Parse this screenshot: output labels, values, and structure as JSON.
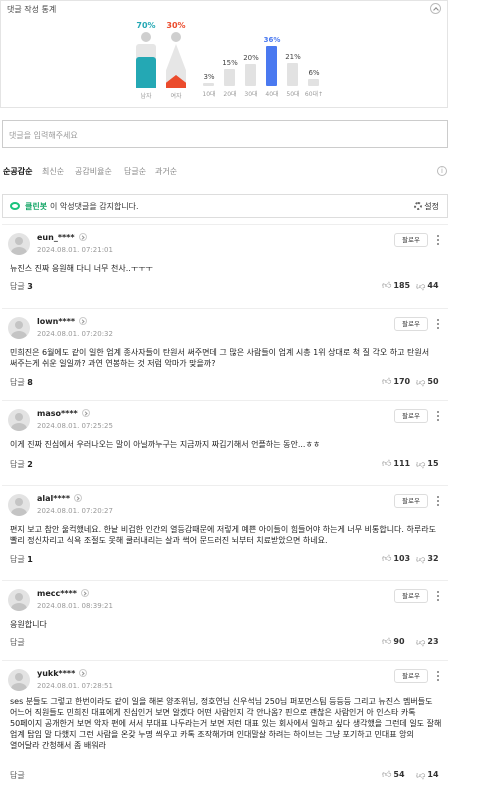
{
  "stats": {
    "title": "댓글 작성 통계",
    "male_pct": "70%",
    "female_pct": "30%",
    "male_label": "남자",
    "female_label": "여자",
    "male_value": 70,
    "female_value": 30,
    "male_color": "#24a8b4",
    "female_color": "#eb4b2c",
    "highlight_color": "#4a79f0",
    "ages": [
      {
        "label": "10대",
        "pct": "3%",
        "value": 3
      },
      {
        "label": "20대",
        "pct": "15%",
        "value": 15
      },
      {
        "label": "30대",
        "pct": "20%",
        "value": 20
      },
      {
        "label": "40대",
        "pct": "36%",
        "value": 36,
        "highlight": true
      },
      {
        "label": "50대",
        "pct": "21%",
        "value": 21
      },
      {
        "label": "60대↑",
        "pct": "6%",
        "value": 6
      }
    ]
  },
  "input": {
    "placeholder": "댓글을 입력해주세요"
  },
  "sort_tabs": [
    "순공감순",
    "최신순",
    "공감비율순",
    "답글순",
    "과거순"
  ],
  "cleanbot": {
    "brand": "클린봇",
    "text": "이 악성댓글을 감지합니다.",
    "settings": "설정"
  },
  "follow_label": "팔로우",
  "reply_label": "답글",
  "comments": [
    {
      "user": "eun_****",
      "time": "2024.08.01. 07:21:01",
      "text": "뉴진스 진짜 응원해 다니 너무 천사..ㅜㅜㅜ",
      "replies": "3",
      "up": "185",
      "down": "44"
    },
    {
      "user": "lown****",
      "time": "2024.08.01. 07:20:32",
      "text": "민희진은 6월에도 같이 일한 업계 종사자들이 탄원서 써주면데 그 많은 사람들이 업계 시총 1위 상대로 척 질 각오 하고 탄원서 써주는게 쉬운 일일까? 과연 연봉하는 것 저럼 악마가 맞을까?",
      "replies": "8",
      "up": "170",
      "down": "50"
    },
    {
      "user": "maso****",
      "time": "2024.08.01. 07:25:25",
      "text": "이게 진짜 진심에서 우러나오는 말이 아닐까누구는 지금까지 짜깁기해서 언플하는 동안...ㅎㅎ",
      "replies": "2",
      "up": "111",
      "down": "15"
    },
    {
      "user": "alal****",
      "time": "2024.08.01. 07:20:27",
      "text": "편지 보고 참안 울컥했네요. 한낱 비겁한 인간의 열등감때문에 저렇게 예쁜 아이들이 힘들어야 하는게 너무 비통합니다. 하루라도 빨리 정신차리고 식욕 조절도 못해 쿨러내리는 살과 썩어 문드러진 뇌부터 치료받았으면 하네요.",
      "replies": "1",
      "up": "103",
      "down": "32"
    },
    {
      "user": "mecc****",
      "time": "2024.08.01. 08:39:21",
      "text": "응원합니다",
      "replies": "",
      "up": "90",
      "down": "23"
    },
    {
      "user": "yukk****",
      "time": "2024.08.01. 07:28:51",
      "text": "ses 분들도 그렇고 한번이라도 같이 일을 해본 양조위님, 정호연님 신우석님 250님 퍼포먼스팀 등등등 그리고 뉴진스 멤버들도 어느어 직원들도 민희진 대표에게 진심인거 보면 알겠다 어떤 사람인지 각 안나옴? 핀으로 괜찮은 사람인거 아 인스타 카톡 50페이지 공개한거 보면 악자 편에 서서 부대표 나두라는거 보면 저런 대표 있는 회사에서 일하고 싶다 생각했을 그런데 일도 잘해 업계 탑임 말 다했지 그런 사람을 온갖 누명 씌우고 카톡 조작해가며 인대말살 하려는 하이브는 그냥 포기하고 민대표 앙의 열어달라 간청해서 좀 배워라",
      "replies": "",
      "up": "54",
      "down": "14"
    }
  ]
}
